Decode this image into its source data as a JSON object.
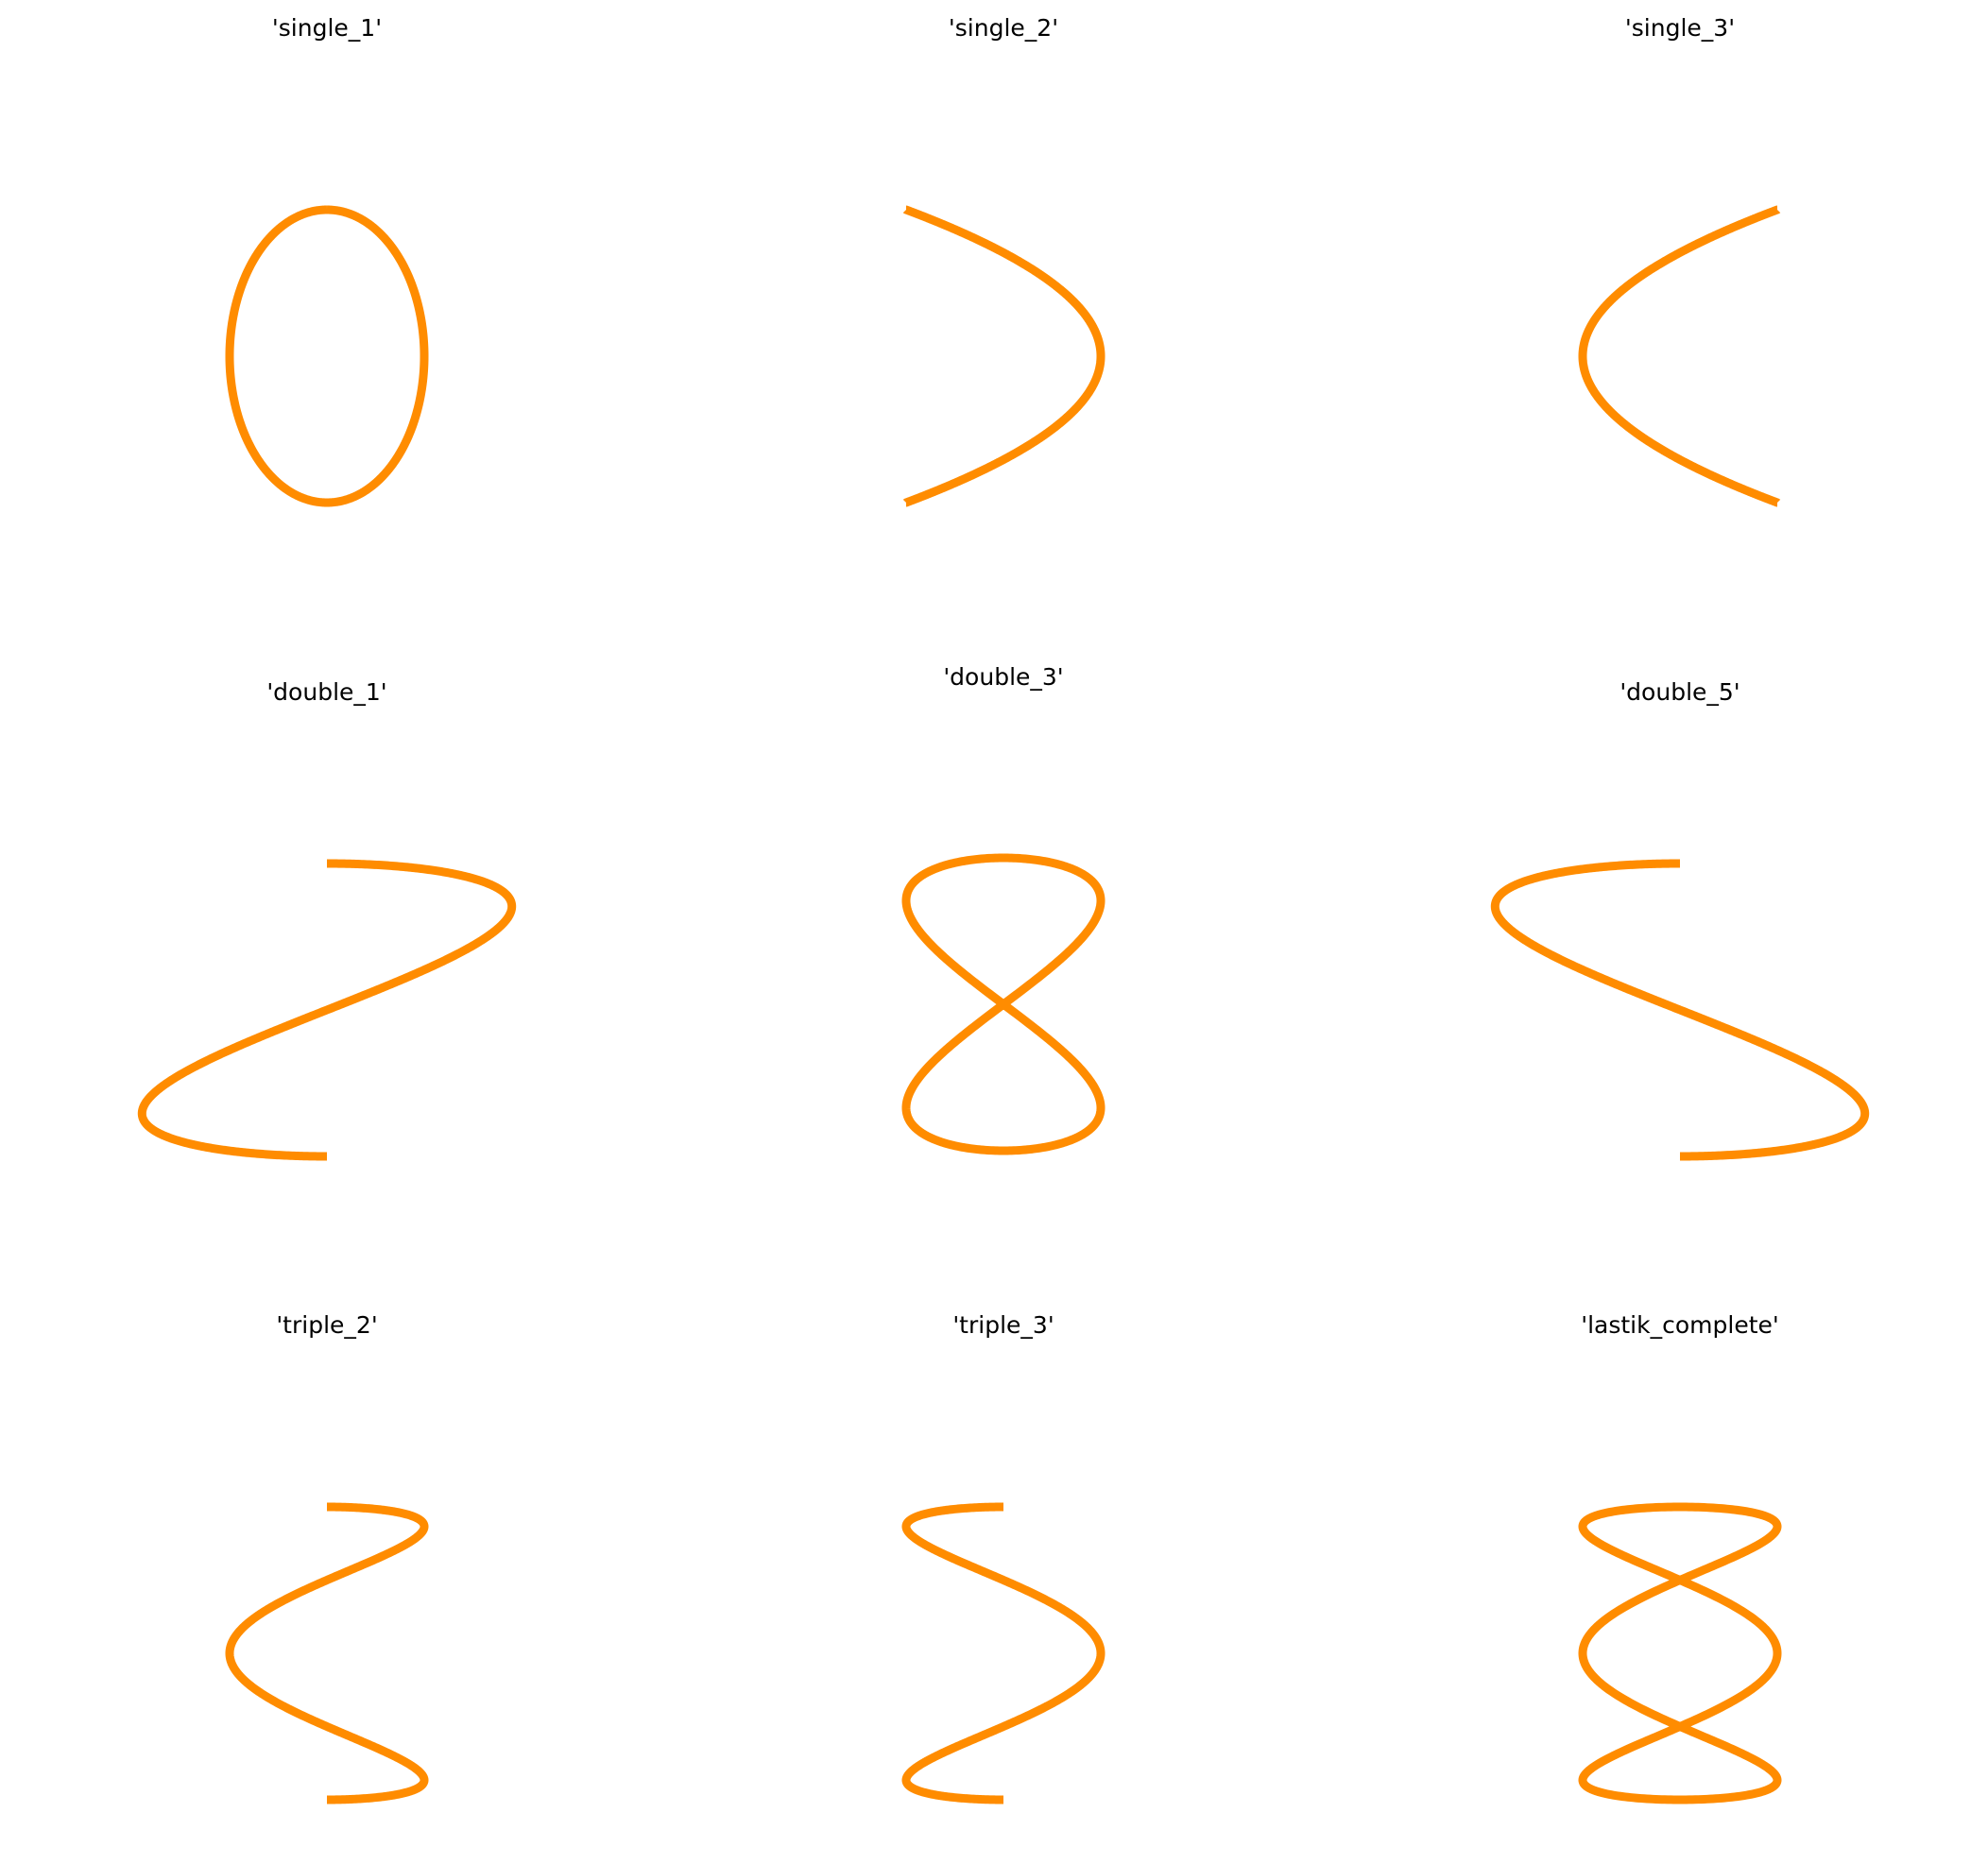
{
  "figure": {
    "accent_color": "#ff8c00",
    "background": "#ffffff",
    "axes_visible": false
  },
  "chart_data": [
    {
      "type": "line",
      "title": "'single_1'",
      "curve": "parametric",
      "x_function": "sin(t)",
      "y_function": "cos(t)",
      "t_range": [
        0,
        6.2832
      ],
      "shape": "closed ellipse",
      "xlim": [
        -2,
        2
      ],
      "ylim": [
        -1.2,
        1.2
      ],
      "color": "#ff8c00"
    },
    {
      "type": "line",
      "title": "'single_2'",
      "curve": "parametric",
      "x_function": "cos(t)",
      "y_function": "sin(t/2)",
      "t_range": [
        -3.1416,
        3.1416
      ],
      "shape": "arc opening to the right",
      "xlim": [
        -2,
        2
      ],
      "ylim": [
        -1.2,
        1.2
      ],
      "color": "#ff8c00"
    },
    {
      "type": "line",
      "title": "'single_3'",
      "curve": "parametric",
      "x_function": "-cos(t)",
      "y_function": "sin(t/2)",
      "t_range": [
        -3.1416,
        3.1416
      ],
      "shape": "arc opening to the left",
      "xlim": [
        -2,
        2
      ],
      "ylim": [
        -1.2,
        1.2
      ],
      "color": "#ff8c00"
    },
    {
      "type": "line",
      "title": "'double_1'",
      "curve": "parametric",
      "x_function": "-1.9*sin(t)",
      "y_function": "-cos(t/2)",
      "t_range": [
        0,
        6.2832
      ],
      "shape": "two lobes, crossing at upper third",
      "xlim": [
        -2,
        2
      ],
      "ylim": [
        -1.2,
        1.2
      ],
      "color": "#ff8c00"
    },
    {
      "type": "line",
      "title": "'double_3'",
      "curve": "parametric",
      "x_function": "sin(2t)",
      "y_function": "cos(t)",
      "t_range": [
        0,
        6.2832
      ],
      "shape": "figure eight",
      "xlim": [
        -2,
        2
      ],
      "ylim": [
        -1.2,
        1.2
      ],
      "color": "#ff8c00"
    },
    {
      "type": "line",
      "title": "'double_5'",
      "curve": "parametric",
      "x_function": "-1.9*sin(t)",
      "y_function": "cos(t/2)",
      "t_range": [
        0,
        6.2832
      ],
      "shape": "two lobes, crossing at lower third",
      "xlim": [
        -2,
        2
      ],
      "ylim": [
        -1.2,
        1.2
      ],
      "color": "#ff8c00"
    },
    {
      "type": "line",
      "title": "'triple_2'",
      "curve": "parametric",
      "x_function": "sin(3t)",
      "y_function": "cos(t)",
      "t_range": [
        0,
        3.1416
      ],
      "shape": "three lobes, open",
      "xlim": [
        -2,
        2
      ],
      "ylim": [
        -1.2,
        1.2
      ],
      "color": "#ff8c00"
    },
    {
      "type": "line",
      "title": "'triple_3'",
      "curve": "parametric",
      "x_function": "-sin(3t)",
      "y_function": "cos(t)",
      "t_range": [
        0,
        3.1416
      ],
      "shape": "three lobes, open, mirrored",
      "xlim": [
        -2,
        2
      ],
      "ylim": [
        -1.2,
        1.2
      ],
      "color": "#ff8c00"
    },
    {
      "type": "line",
      "title": "'lastik_complete'",
      "curve": "parametric",
      "x_function": "sin(3t)",
      "y_function": "cos(t)",
      "t_range": [
        0,
        6.2832
      ],
      "shape": "three lobes, closed",
      "xlim": [
        -2,
        2
      ],
      "ylim": [
        -1.2,
        1.2
      ],
      "color": "#ff8c00"
    }
  ]
}
